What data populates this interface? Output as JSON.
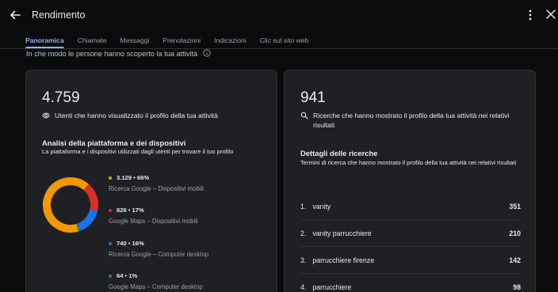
{
  "header": {
    "title": "Rendimento"
  },
  "tabs": [
    {
      "label": "Panoramica",
      "active": true
    },
    {
      "label": "Chiamate"
    },
    {
      "label": "Messaggi"
    },
    {
      "label": "Prenotazioni"
    },
    {
      "label": "Indicazioni"
    },
    {
      "label": "Clic sul sito web"
    }
  ],
  "section": {
    "heading": "In che modo le persone hanno scoperto la tua attività"
  },
  "left_card": {
    "big_number": "4.759",
    "metric_label": "Utenti che hanno visualizzato il profilo della tua attività",
    "analysis_title": "Analisi della piattaforma e dei dispositivi",
    "analysis_desc": "La piattaforma e i dispositivi utilizzati dagli utenti per trovare il tuo profilo",
    "breakdown": [
      {
        "value": "3.129 • 66%",
        "label": "Ricerca Google – Dispositivi mobili",
        "percent": 66,
        "color": "#f29900"
      },
      {
        "value": "826 • 17%",
        "label": "Google Maps – Dispositivi mobili",
        "percent": 17,
        "color": "#d93025"
      },
      {
        "value": "740 • 16%",
        "label": "Ricerca Google – Computer desktop",
        "percent": 16,
        "color": "#1a73e8"
      },
      {
        "value": "64 • 1%",
        "label": "Google Maps – Computer desktop",
        "percent": 1,
        "color": "#1e8e3e"
      }
    ]
  },
  "right_card": {
    "big_number": "941",
    "metric_label": "Ricerche che hanno mostrato il profilo della tua attività nei relativi risultati",
    "details_title": "Dettagli delle ricerche",
    "details_desc": "Termini di ricerca che hanno mostrato il profilo della tua attività nei relativi risultati",
    "searches": [
      {
        "rank": "1.",
        "term": "vanity",
        "count": "351"
      },
      {
        "rank": "2.",
        "term": "vanity parrucchiere",
        "count": "210"
      },
      {
        "rank": "3.",
        "term": "parrucchiere firenze",
        "count": "142"
      },
      {
        "rank": "4.",
        "term": "parrucchiere",
        "count": "98"
      }
    ]
  },
  "colors": {
    "background": "#0b0b0d",
    "card": "#1f2023",
    "accent": "#8ab4f8"
  }
}
